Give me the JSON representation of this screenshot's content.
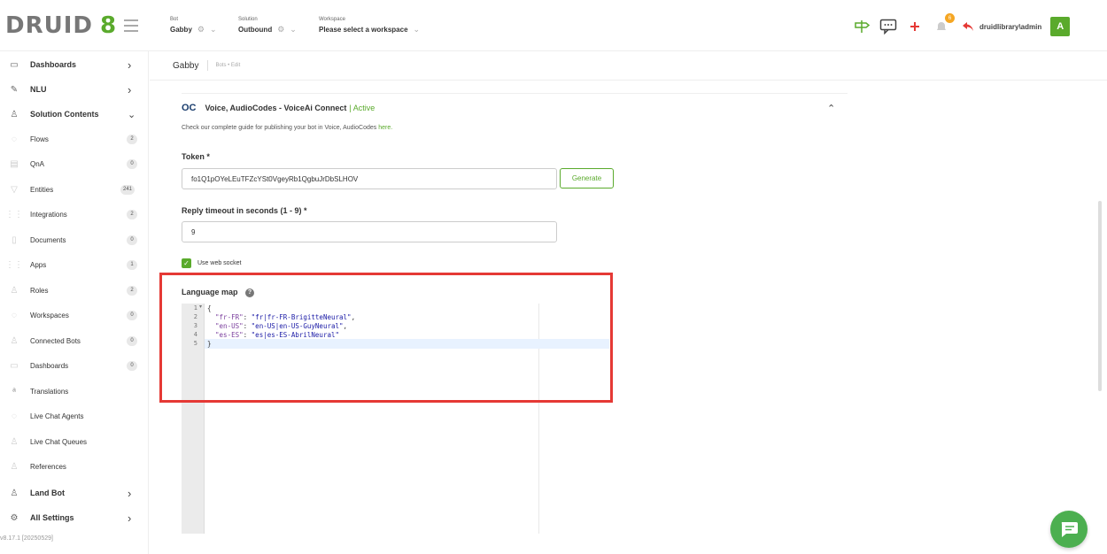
{
  "app": {
    "logo_text": "DRUID",
    "logo_version": "8",
    "version": "v8.17.1 [20250529]"
  },
  "header": {
    "bot": {
      "label": "Bot",
      "value": "Gabby"
    },
    "solution": {
      "label": "Solution",
      "value": "Outbound"
    },
    "workspace": {
      "label": "Workspace",
      "value": "Please select a workspace"
    },
    "notification_count": "6",
    "user": "druidlibrary\\admin",
    "avatar_letter": "A"
  },
  "sidebar": {
    "main": [
      {
        "label": "Dashboards",
        "icon": "dashboard-icon"
      },
      {
        "label": "NLU",
        "icon": "nlu-icon"
      },
      {
        "label": "Solution Contents",
        "icon": "solution-icon"
      }
    ],
    "sub": [
      {
        "label": "Flows",
        "count": "2"
      },
      {
        "label": "QnA",
        "count": "0"
      },
      {
        "label": "Entities",
        "count": "241"
      },
      {
        "label": "Integrations",
        "count": "2"
      },
      {
        "label": "Documents",
        "count": "0"
      },
      {
        "label": "Apps",
        "count": "1"
      },
      {
        "label": "Roles",
        "count": "2"
      },
      {
        "label": "Workspaces",
        "count": "0"
      },
      {
        "label": "Connected Bots",
        "count": "0"
      },
      {
        "label": "Dashboards",
        "count": "0"
      },
      {
        "label": "Translations",
        "count": ""
      },
      {
        "label": "Live Chat Agents",
        "count": ""
      },
      {
        "label": "Live Chat Queues",
        "count": ""
      },
      {
        "label": "References",
        "count": ""
      }
    ],
    "bottom": [
      {
        "label": "Land Bot",
        "icon": "landbot-icon"
      },
      {
        "label": "All Settings",
        "icon": "settings-icon"
      }
    ]
  },
  "breadcrumb": {
    "title": "Gabby",
    "path": "Bots • Edit"
  },
  "channel": {
    "name": "Voice, AudioCodes - VoiceAi Connect",
    "status": "| Active",
    "guide_text": "Check our complete guide for publishing your bot in Voice, AudioCodes ",
    "guide_link": "here.",
    "token_label": "Token *",
    "token_value": "fo1Q1pOYeLEuTFZcYSt0VgeyRb1QgbuJrDbSLHOV",
    "generate_label": "Generate",
    "timeout_label": "Reply timeout in seconds (1 - 9) *",
    "timeout_value": "9",
    "websocket_label": "Use web socket",
    "websocket_checked": true,
    "language_map_label": "Language map"
  },
  "editor": {
    "line_numbers": [
      "1",
      "2",
      "3",
      "4",
      "5"
    ],
    "lines": [
      {
        "text": "{"
      },
      {
        "key": "\"fr-FR\"",
        "value": "\"fr|fr-FR-BrigitteNeural\"",
        "trail": ","
      },
      {
        "key": "\"en-US\"",
        "value": "\"en-US|en-US-GuyNeural\"",
        "trail": ","
      },
      {
        "key": "\"es-ES\"",
        "value": "\"es|es-ES-AbrilNeural\"",
        "trail": ""
      },
      {
        "text": "}"
      }
    ]
  },
  "colors": {
    "brand_green": "#5aaa2c",
    "highlight_red": "#e53935"
  }
}
